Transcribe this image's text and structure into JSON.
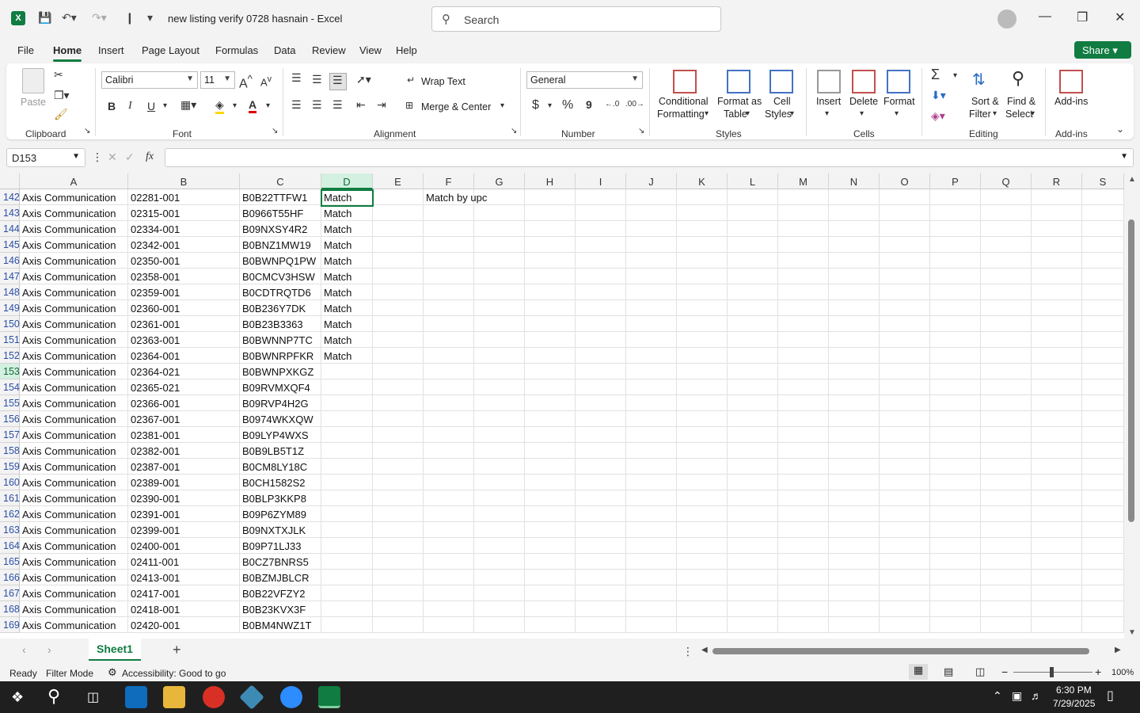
{
  "titlebar": {
    "title": "new listing verify 0728 hasnain  -  Excel",
    "search_placeholder": "Search"
  },
  "menu_tabs": [
    "File",
    "Home",
    "Insert",
    "Page Layout",
    "Formulas",
    "Data",
    "Review",
    "View",
    "Help"
  ],
  "active_tab": "Home",
  "share_label": "Share",
  "ribbon": {
    "paste": "Paste",
    "font_name": "Calibri",
    "font_size": "11",
    "wrap_text": "Wrap Text",
    "merge_center": "Merge & Center",
    "number_format": "General",
    "conditional_formatting": [
      "Conditional",
      "Formatting"
    ],
    "format_as_table": [
      "Format as",
      "Table"
    ],
    "cell_styles": [
      "Cell",
      "Styles"
    ],
    "insert": "Insert",
    "delete": "Delete",
    "format": "Format",
    "sort_filter": [
      "Sort &",
      "Filter"
    ],
    "find_select": [
      "Find &",
      "Select"
    ],
    "add_ins": "Add-ins",
    "groups": {
      "clipboard": "Clipboard",
      "font": "Font",
      "alignment": "Alignment",
      "number": "Number",
      "styles": "Styles",
      "cells": "Cells",
      "editing": "Editing",
      "addins": "Add-ins"
    },
    "currency": "$",
    "percent": "%",
    "comma": "9",
    "bold": "B",
    "italic": "I",
    "underline": "U",
    "increase_font": "A",
    "decrease_font": "A"
  },
  "name_box": "D153",
  "formula_fx": "fx",
  "columns": [
    "A",
    "B",
    "C",
    "D",
    "E",
    "F",
    "G",
    "H",
    "I",
    "J",
    "K",
    "L",
    "M",
    "N",
    "O",
    "P",
    "Q",
    "R",
    "S"
  ],
  "selected_column": "D",
  "rows": [
    {
      "n": "142",
      "a": "Axis Communication",
      "b": "02281-001",
      "c": "B0B22TTFW1",
      "d": "Match",
      "f": "Match by upc"
    },
    {
      "n": "143",
      "a": "Axis Communication",
      "b": "02315-001",
      "c": "B0966T55HF",
      "d": "Match",
      "f": ""
    },
    {
      "n": "144",
      "a": "Axis Communication",
      "b": "02334-001",
      "c": "B09NXSY4R2",
      "d": "Match",
      "f": ""
    },
    {
      "n": "145",
      "a": "Axis Communication",
      "b": "02342-001",
      "c": "B0BNZ1MW19",
      "d": "Match",
      "f": ""
    },
    {
      "n": "146",
      "a": "Axis Communication",
      "b": "02350-001",
      "c": "B0BWNPQ1PW",
      "d": "Match",
      "f": ""
    },
    {
      "n": "147",
      "a": "Axis Communication",
      "b": "02358-001",
      "c": "B0CMCV3HSW",
      "d": "Match",
      "f": ""
    },
    {
      "n": "148",
      "a": "Axis Communication",
      "b": "02359-001",
      "c": "B0CDTRQTD6",
      "d": "Match",
      "f": ""
    },
    {
      "n": "149",
      "a": "Axis Communication",
      "b": "02360-001",
      "c": "B0B236Y7DK",
      "d": "Match",
      "f": ""
    },
    {
      "n": "150",
      "a": "Axis Communication",
      "b": "02361-001",
      "c": "B0B23B3363",
      "d": "Match",
      "f": ""
    },
    {
      "n": "151",
      "a": "Axis Communication",
      "b": "02363-001",
      "c": "B0BWNNP7TC",
      "d": "Match",
      "f": ""
    },
    {
      "n": "152",
      "a": "Axis Communication",
      "b": "02364-001",
      "c": "B0BWNRPFKR",
      "d": "Match",
      "f": ""
    },
    {
      "n": "153",
      "a": "Axis Communication",
      "b": "02364-021",
      "c": "B0BWNPXKGZ",
      "d": "",
      "f": ""
    },
    {
      "n": "154",
      "a": "Axis Communication",
      "b": "02365-021",
      "c": "B09RVMXQF4",
      "d": "",
      "f": ""
    },
    {
      "n": "155",
      "a": "Axis Communication",
      "b": "02366-001",
      "c": "B09RVP4H2G",
      "d": "",
      "f": ""
    },
    {
      "n": "156",
      "a": "Axis Communication",
      "b": "02367-001",
      "c": "B0974WKXQW",
      "d": "",
      "f": ""
    },
    {
      "n": "157",
      "a": "Axis Communication",
      "b": "02381-001",
      "c": "B09LYP4WXS",
      "d": "",
      "f": ""
    },
    {
      "n": "158",
      "a": "Axis Communication",
      "b": "02382-001",
      "c": "B0B9LB5T1Z",
      "d": "",
      "f": ""
    },
    {
      "n": "159",
      "a": "Axis Communication",
      "b": "02387-001",
      "c": "B0CM8LY18C",
      "d": "",
      "f": ""
    },
    {
      "n": "160",
      "a": "Axis Communication",
      "b": "02389-001",
      "c": "B0CH1582S2",
      "d": "",
      "f": ""
    },
    {
      "n": "161",
      "a": "Axis Communication",
      "b": "02390-001",
      "c": "B0BLP3KKP8",
      "d": "",
      "f": ""
    },
    {
      "n": "162",
      "a": "Axis Communication",
      "b": "02391-001",
      "c": "B09P6ZYM89",
      "d": "",
      "f": ""
    },
    {
      "n": "163",
      "a": "Axis Communication",
      "b": "02399-001",
      "c": "B09NXTXJLK",
      "d": "",
      "f": ""
    },
    {
      "n": "164",
      "a": "Axis Communication",
      "b": "02400-001",
      "c": "B09P71LJ33",
      "d": "",
      "f": ""
    },
    {
      "n": "165",
      "a": "Axis Communication",
      "b": "02411-001",
      "c": "B0CZ7BNRS5",
      "d": "",
      "f": ""
    },
    {
      "n": "166",
      "a": "Axis Communication",
      "b": "02413-001",
      "c": "B0BZMJBLCR",
      "d": "",
      "f": ""
    },
    {
      "n": "167",
      "a": "Axis Communication",
      "b": "02417-001",
      "c": "B0B22VFZY2",
      "d": "",
      "f": ""
    },
    {
      "n": "168",
      "a": "Axis Communication",
      "b": "02418-001",
      "c": "B0B23KVX3F",
      "d": "",
      "f": ""
    },
    {
      "n": "169",
      "a": "Axis Communication",
      "b": "02420-001",
      "c": "B0BM4NWZ1T",
      "d": "",
      "f": ""
    }
  ],
  "active_row": "153",
  "sheet_tab": "Sheet1",
  "statusbar": {
    "ready": "Ready",
    "filter_mode": "Filter Mode",
    "accessibility": "Accessibility: Good to go",
    "zoom": "100%"
  },
  "taskbar": {
    "time": "6:30 PM",
    "date": "7/29/2025"
  },
  "colors": {
    "excel_green": "#107c41",
    "row_number_blue": "#2b4fa8"
  }
}
